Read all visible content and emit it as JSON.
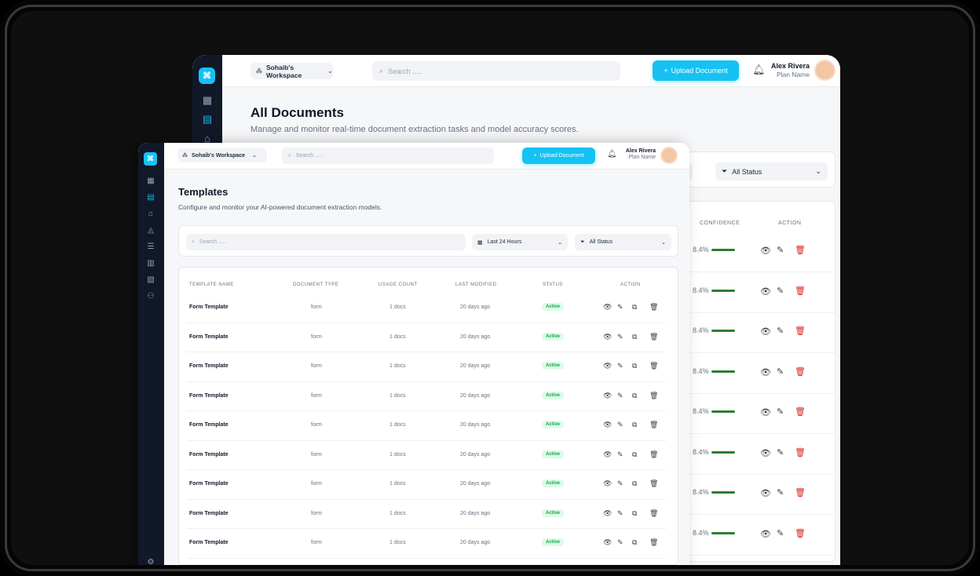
{
  "back": {
    "workspace": "Sohaib's Workspace",
    "search_placeholder": "Search .....",
    "upload_label": "Upload Document",
    "user_name": "Alex Rivera",
    "user_plan": "Plan Name",
    "page_title": "All Documents",
    "page_subtitle": "Manage and monitor real-time document extraction tasks and model accuracy scores.",
    "status_filter": "All Status",
    "columns": {
      "confidence": "CONFIDENCE",
      "action": "ACTION"
    },
    "rows": [
      "8.4%",
      "8.4%",
      "8.4%",
      "8.4%",
      "8.4%",
      "8.4%",
      "8.4%",
      "8.4%"
    ]
  },
  "front": {
    "workspace": "Sohaib's Workspace",
    "search_placeholder": "Search .....",
    "upload_label": "Upload Document",
    "user_name": "Alex Rivera",
    "user_plan": "Plan Name",
    "page_title": "Templates",
    "page_subtitle": "Configure and monitor your AI-powered document extraction models.",
    "filter_search_placeholder": "Search .....",
    "date_filter": "Last 24 Hours",
    "status_filter": "All Status",
    "columns": {
      "name": "TEMPLATE NAME",
      "type": "DOCUMENT TYPE",
      "usage": "USAGE COUNT",
      "modified": "LAST MODIFIED",
      "status": "STATUS",
      "action": "ACTION"
    },
    "rows": [
      {
        "name": "Form Template",
        "type": "form",
        "usage": "1 docs",
        "modified": "20 days ago",
        "status": "Active"
      },
      {
        "name": "Form Template",
        "type": "form",
        "usage": "1 docs",
        "modified": "20 days ago",
        "status": "Active"
      },
      {
        "name": "Form Template",
        "type": "form",
        "usage": "1 docs",
        "modified": "20 days ago",
        "status": "Active"
      },
      {
        "name": "Form Template",
        "type": "form",
        "usage": "1 docs",
        "modified": "20 days ago",
        "status": "Active"
      },
      {
        "name": "Form Template",
        "type": "form",
        "usage": "1 docs",
        "modified": "20 days ago",
        "status": "Active"
      },
      {
        "name": "Form Template",
        "type": "form",
        "usage": "1 docs",
        "modified": "20 days ago",
        "status": "Active"
      },
      {
        "name": "Form Template",
        "type": "form",
        "usage": "1 docs",
        "modified": "20 days ago",
        "status": "Active"
      },
      {
        "name": "Form Template",
        "type": "form",
        "usage": "1 docs",
        "modified": "20 days ago",
        "status": "Active"
      },
      {
        "name": "Form Template",
        "type": "form",
        "usage": "1 docs",
        "modified": "20 days ago",
        "status": "Active"
      }
    ]
  },
  "colors": {
    "accent": "#16c2f3",
    "sidebar": "#111827",
    "active_badge": "#16a34a",
    "delete": "#dc2626"
  }
}
